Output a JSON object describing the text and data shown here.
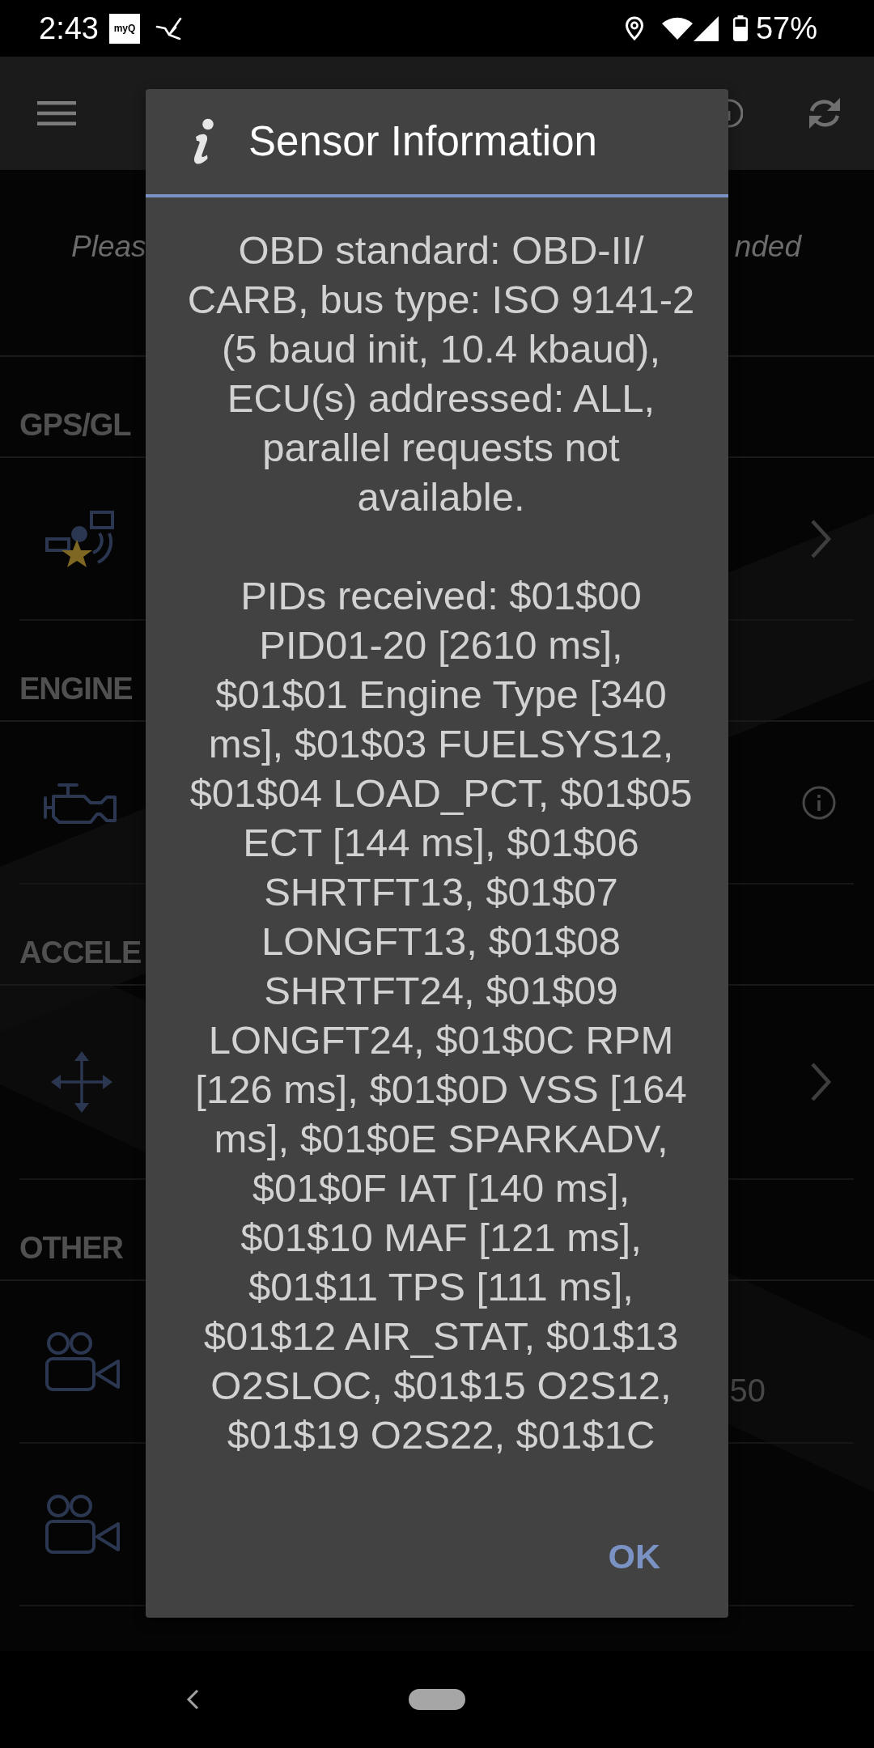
{
  "status_bar": {
    "time": "2:43",
    "app_badge": "myQ",
    "battery_percent": "57%"
  },
  "hint": {
    "visible_start": "Pleas",
    "visible_end": "nded"
  },
  "sections": [
    {
      "title": "GPS/GL",
      "rows": [
        {
          "kind": "link"
        }
      ]
    },
    {
      "title": "ENGINE",
      "rows": [
        {
          "kind": "info"
        }
      ]
    },
    {
      "title": "ACCELE",
      "rows": [
        {
          "kind": "link"
        }
      ]
    },
    {
      "title": "OTHER",
      "rows": [
        {
          "kind": "value",
          "value": "50"
        },
        {
          "kind": "plain"
        }
      ]
    }
  ],
  "dialog": {
    "title": "Sensor Information",
    "paragraphs": [
      "OBD standard: OBD-II/\nCARB, bus type: ISO 9141-2\n(5 baud init, 10.4 kbaud),\nECU(s) addressed: ALL,\nparallel requests not\navailable.",
      "PIDs received: $01$00\nPID01-20 [2610 ms],\n$01$01 Engine Type [340\nms], $01$03 FUELSYS12,\n$01$04 LOAD_PCT, $01$05\nECT [144 ms], $01$06\nSHRTFT13, $01$07\nLONGFT13, $01$08\nSHRTFT24, $01$09\nLONGFT24, $01$0C RPM\n[126 ms], $01$0D VSS [164\nms], $01$0E SPARKADV,\n$01$0F IAT [140 ms],\n$01$10 MAF [121 ms],\n$01$11 TPS [111 ms],\n$01$12 AIR_STAT, $01$13\nO2SLOC, $01$15 O2S12,\n$01$19 O2S22, $01$1C"
    ],
    "button": "OK"
  }
}
